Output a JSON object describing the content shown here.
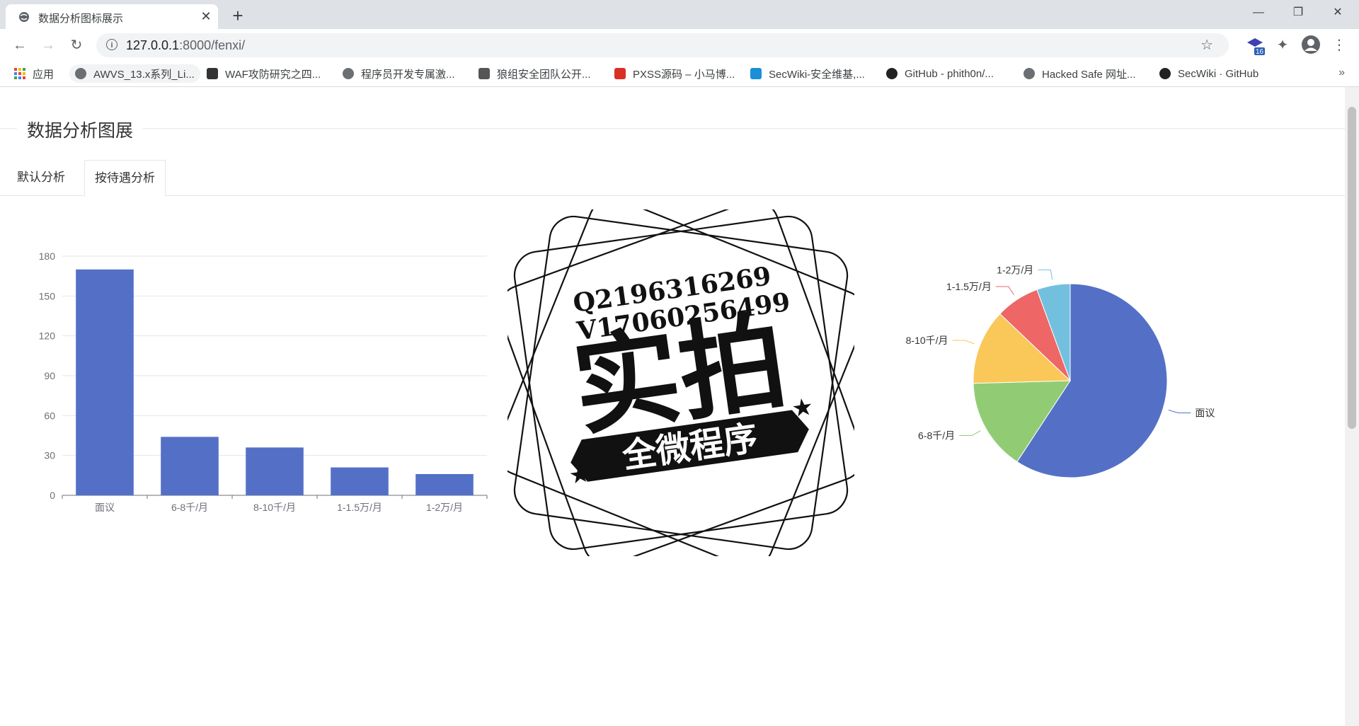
{
  "browser": {
    "tab_title": "数据分析图标展示",
    "url_host": "127.0.0.1",
    "url_port_path": ":8000/fenxi/",
    "extension_badge": "16",
    "bookmarks": [
      {
        "label": "应用",
        "icon": "apps-grid-icon"
      },
      {
        "label": "AWVS_13.x系列_Li...",
        "icon": "globe-icon"
      },
      {
        "label": "WAF攻防研究之四...",
        "icon": "fork-icon"
      },
      {
        "label": "程序员开发专属激...",
        "icon": "globe-icon"
      },
      {
        "label": "狼组安全团队公开...",
        "icon": "wolf-icon"
      },
      {
        "label": "PXSS源码 – 小马博...",
        "icon": "p-icon"
      },
      {
        "label": "SecWiki-安全维基,...",
        "icon": "secwiki-icon"
      },
      {
        "label": "GitHub - phith0n/...",
        "icon": "github-icon"
      },
      {
        "label": "Hacked Safe 网址...",
        "icon": "globe-icon"
      },
      {
        "label": "SecWiki · GitHub",
        "icon": "github-icon"
      }
    ]
  },
  "page": {
    "title": "数据分析图展",
    "tabs": [
      {
        "label": "默认分析",
        "active": false
      },
      {
        "label": "按待遇分析",
        "active": true
      }
    ]
  },
  "watermark": {
    "line1": "Q2196316269",
    "line2": "V17060256499",
    "big": "实拍",
    "banner": "全微程序"
  },
  "chart_data": [
    {
      "type": "bar",
      "categories": [
        "面议",
        "6-8千/月",
        "8-10千/月",
        "1-1.5万/月",
        "1-2万/月"
      ],
      "values": [
        170,
        44,
        36,
        21,
        16
      ],
      "ylim": [
        0,
        180
      ],
      "yticks": [
        0,
        30,
        60,
        90,
        120,
        150,
        180
      ],
      "color": "#5470c6",
      "grid": true
    },
    {
      "type": "pie",
      "labels": [
        "面议",
        "6-8千/月",
        "8-10千/月",
        "1-1.5万/月",
        "1-2万/月"
      ],
      "values": [
        170,
        44,
        36,
        21,
        16
      ],
      "colors": [
        "#5470c6",
        "#91cc75",
        "#fac858",
        "#ee6666",
        "#73c0de"
      ]
    }
  ]
}
